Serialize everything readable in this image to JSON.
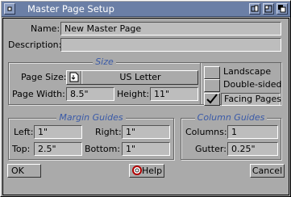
{
  "window": {
    "title": "Master Page Setup"
  },
  "name": {
    "label": "Name:",
    "value": "New Master Page"
  },
  "description": {
    "label": "Description:",
    "value": ""
  },
  "size": {
    "title": "Size",
    "page_size_label": "Page Size:",
    "page_size_value": "US Letter",
    "page_width_label": "Page Width:",
    "page_width_value": "8.5\"",
    "height_label": "Height:",
    "height_value": "11\""
  },
  "options": [
    {
      "label": "Landscape",
      "checked": false
    },
    {
      "label": "Double-sided",
      "checked": false
    },
    {
      "label": "Facing Pages",
      "checked": true
    }
  ],
  "margin_guides": {
    "title": "Margin Guides",
    "left_label": "Left:",
    "left_value": "1\"",
    "right_label": "Right:",
    "right_value": "1\"",
    "top_label": "Top:",
    "top_value": "2.5\"",
    "bottom_label": "Bottom:",
    "bottom_value": "1\""
  },
  "column_guides": {
    "title": "Column Guides",
    "columns_label": "Columns:",
    "columns_value": "1",
    "gutter_label": "Gutter:",
    "gutter_value": "0.25\""
  },
  "buttons": {
    "ok": "OK",
    "help": "Help",
    "cancel": "Cancel"
  }
}
